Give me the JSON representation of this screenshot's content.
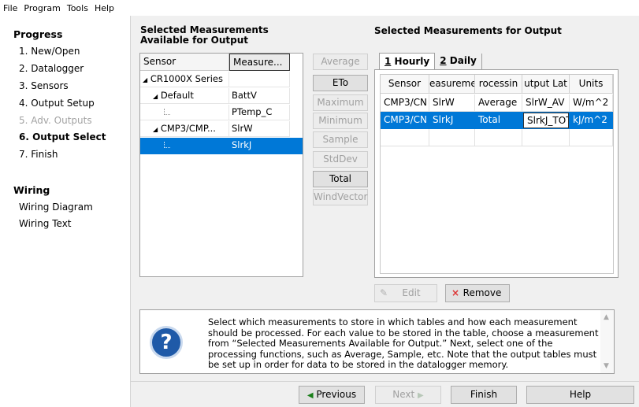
{
  "menu": [
    "File",
    "Program",
    "Tools",
    "Help"
  ],
  "sidebar": {
    "progress_heading": "Progress",
    "steps": [
      {
        "label": "1. New/Open",
        "state": "normal"
      },
      {
        "label": "2. Datalogger",
        "state": "normal"
      },
      {
        "label": "3. Sensors",
        "state": "normal"
      },
      {
        "label": "4. Output Setup",
        "state": "normal"
      },
      {
        "label": "5. Adv. Outputs",
        "state": "disabled"
      },
      {
        "label": "6. Output Select",
        "state": "active"
      },
      {
        "label": "7. Finish",
        "state": "normal"
      }
    ],
    "wiring_heading": "Wiring",
    "wiring_items": [
      "Wiring Diagram",
      "Wiring Text"
    ]
  },
  "available": {
    "heading_line1": "Selected Measurements",
    "heading_line2": "Available for Output",
    "columns": [
      "Sensor",
      "Measure..."
    ],
    "rows": [
      {
        "sensor": "CR1000X Series",
        "measurement": "",
        "expander": "◢",
        "indent": 0
      },
      {
        "sensor": "Default",
        "measurement": "BattV",
        "expander": "◢",
        "indent": 1
      },
      {
        "sensor": "",
        "measurement": "PTemp_C",
        "expander": "",
        "indent": 2
      },
      {
        "sensor": "CMP3/CMP...",
        "measurement": "SlrW",
        "expander": "◢",
        "indent": 1
      },
      {
        "sensor": "",
        "measurement": "SlrkJ",
        "expander": "",
        "indent": 2
      }
    ]
  },
  "functions": [
    {
      "label": "Average",
      "enabled": false
    },
    {
      "label": "ETo",
      "enabled": true
    },
    {
      "label": "Maximum",
      "enabled": false
    },
    {
      "label": "Minimum",
      "enabled": false
    },
    {
      "label": "Sample",
      "enabled": false
    },
    {
      "label": "StdDev",
      "enabled": false
    },
    {
      "label": "Total",
      "enabled": true
    },
    {
      "label": "WindVector",
      "enabled": false
    }
  ],
  "output": {
    "heading": "Selected Measurements for Output",
    "tabs": [
      {
        "key": "1",
        "label": " Hourly"
      },
      {
        "key": "2",
        "label": " Daily"
      }
    ],
    "columns": [
      "Sensor",
      "easureme",
      "rocessin",
      "utput Lat",
      "Units"
    ],
    "rows": [
      {
        "sensor": "CMP3/CN",
        "measurement": "SlrW",
        "processing": "Average",
        "output_label": "SlrW_AV",
        "units": "W/m^2"
      },
      {
        "sensor": "CMP3/CN",
        "measurement": "SlrkJ",
        "processing": "Total",
        "output_label": "SlrkJ_TOT",
        "units": "kJ/m^2"
      }
    ],
    "edit_label": "Edit",
    "remove_label": "Remove"
  },
  "help": {
    "text": "Select which measurements to store in which tables and how each measurement should be processed. For each value to be stored in the table, choose a measurement from “Selected Measurements Available for Output.”  Next, select one of the processing functions, such as Average, Sample, etc. Note that the output tables must be set up in order for data to be stored in the datalogger memory."
  },
  "nav": {
    "previous": "Previous",
    "next": "Next",
    "finish": "Finish",
    "help": "Help"
  },
  "colors": {
    "selection": "#0078d7",
    "accent_blue": "#1f5aa8"
  }
}
